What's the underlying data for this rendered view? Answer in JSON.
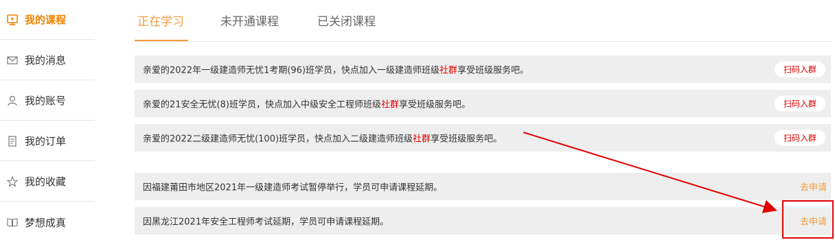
{
  "sidebar": {
    "items": [
      {
        "label": "我的课程",
        "icon": "course-icon",
        "active": true
      },
      {
        "label": "我的消息",
        "icon": "message-icon",
        "active": false
      },
      {
        "label": "我的账号",
        "icon": "user-icon",
        "active": false
      },
      {
        "label": "我的订单",
        "icon": "order-icon",
        "active": false
      },
      {
        "label": "我的收藏",
        "icon": "star-icon",
        "active": false
      },
      {
        "label": "梦想成真",
        "icon": "book-icon",
        "active": false
      }
    ]
  },
  "tabs": [
    {
      "label": "正在学习",
      "active": true
    },
    {
      "label": "未开通课程",
      "active": false
    },
    {
      "label": "已关闭课程",
      "active": false
    }
  ],
  "group_notices": [
    {
      "prefix": "亲爱的2022年一级建造师无忧1考期(96)班学员，快点加入一级建造师班级",
      "highlight": "社群",
      "suffix": "享受班级服务吧。",
      "button": "扫码入群"
    },
    {
      "prefix": "亲爱的21安全无忧(8)班学员，快点加入中级安全工程师班级",
      "highlight": "社群",
      "suffix": "享受班级服务吧。",
      "button": "扫码入群"
    },
    {
      "prefix": "亲爱的2022二级建造师无忧(100)班学员，快点加入二级建造师班级",
      "highlight": "社群",
      "suffix": "享受班级服务吧。",
      "button": "扫码入群"
    }
  ],
  "extension_notices": [
    {
      "text": "因福建莆田市地区2021年一级建造师考试暂停举行，学员可申请课程延期。",
      "action": "去申请"
    },
    {
      "text": "因黑龙江2021年安全工程师考试延期，学员可申请课程延期。",
      "action": "去申请"
    }
  ],
  "colors": {
    "accent": "#f39c40",
    "active_sidebar": "#f08300",
    "highlight_red": "#e00000",
    "row_bg": "#eeeeee"
  }
}
